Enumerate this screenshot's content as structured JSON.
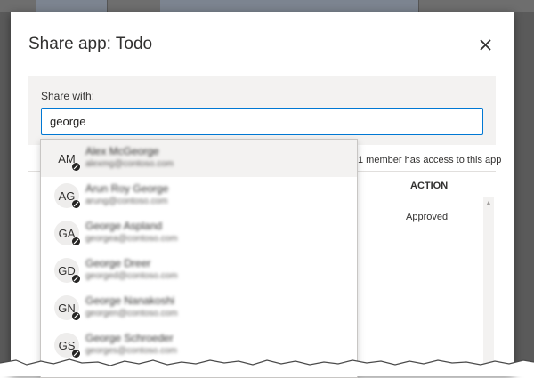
{
  "modal": {
    "title": "Share app: Todo",
    "close_icon": "close-icon"
  },
  "share": {
    "label": "Share with:",
    "input_value": "george"
  },
  "members_text": "1 member has access to this app",
  "table": {
    "column_action": "ACTION",
    "rows": [
      {
        "action": "Approved"
      }
    ]
  },
  "suggestions": [
    {
      "initials": "AM",
      "name": "Alex McGeorge",
      "email": "alexmg@contoso.com",
      "highlighted": true
    },
    {
      "initials": "AG",
      "name": "Arun Roy George",
      "email": "arung@contoso.com",
      "highlighted": false
    },
    {
      "initials": "GA",
      "name": "George Aspland",
      "email": "georgea@contoso.com",
      "highlighted": false
    },
    {
      "initials": "GD",
      "name": "George Dreer",
      "email": "georged@contoso.com",
      "highlighted": false
    },
    {
      "initials": "GN",
      "name": "George Nanakoshi",
      "email": "georgen@contoso.com",
      "highlighted": false
    },
    {
      "initials": "GS",
      "name": "George Schroeder",
      "email": "georges@contoso.com",
      "highlighted": false
    }
  ],
  "colors": {
    "accent": "#0078d4",
    "panel": "#f3f2f1",
    "text": "#323130"
  }
}
